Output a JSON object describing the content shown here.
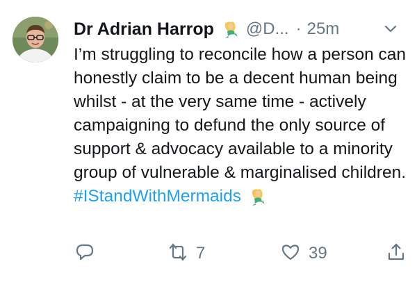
{
  "tweet": {
    "author_name": "Dr Adrian Harrop",
    "handle": "@D...",
    "separator": "·",
    "time": "25m",
    "body": "I’m struggling to reconcile how a person can honestly claim to be a decent human being whilst - at the very same time - actively campaigning to defund the only source of support & advocacy available to a minority group of vulnerable & marginalised children.",
    "hashtag": "#IStandWithMermaids"
  },
  "actions": {
    "retweet_count": "7",
    "like_count": "39"
  },
  "colors": {
    "link": "#1da1f2",
    "secondary_text": "#657786",
    "text": "#14171a"
  },
  "icons": {
    "reply": "reply-icon",
    "retweet": "retweet-icon",
    "like": "heart-icon",
    "share": "share-icon",
    "menu": "chevron-down-icon",
    "emoji": "mermaid-emoji"
  }
}
